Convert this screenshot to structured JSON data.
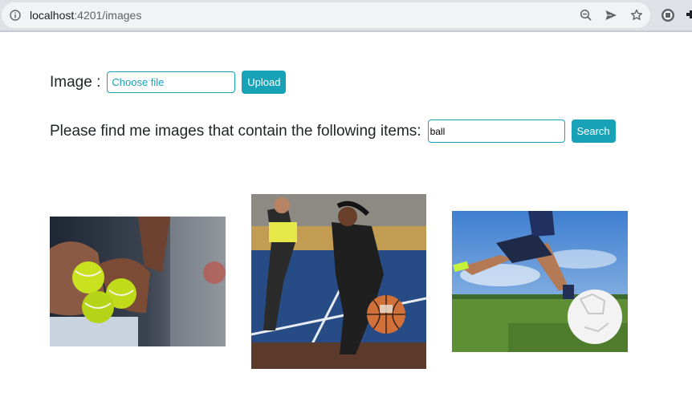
{
  "browser": {
    "url_host": "localhost",
    "url_rest": ":4201/images"
  },
  "upload": {
    "label": "Image :",
    "file_placeholder": "Choose file",
    "upload_button": "Upload"
  },
  "search": {
    "prompt": "Please find me images that contain the following items:",
    "query": "ball",
    "search_button": "Search"
  },
  "results": [
    {
      "description_icon": "tennis-balls-image"
    },
    {
      "description_icon": "basketball-players-image"
    },
    {
      "description_icon": "soccer-kick-image"
    }
  ],
  "colors": {
    "accent": "#17a2b8",
    "text": "#212529"
  }
}
